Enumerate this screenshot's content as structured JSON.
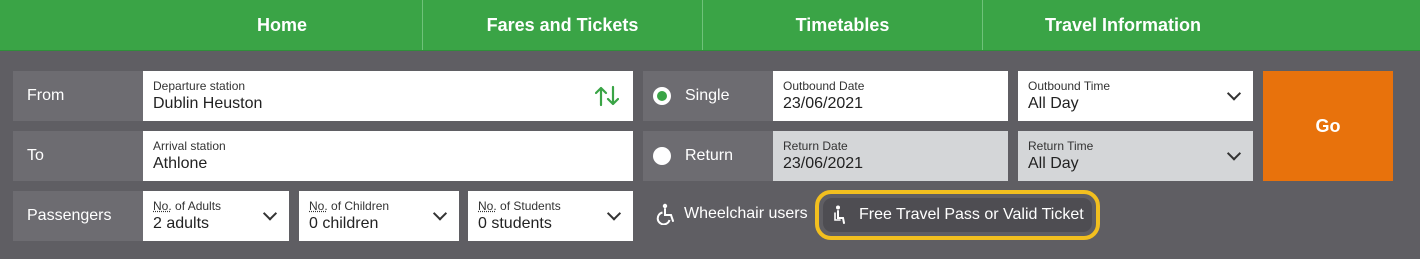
{
  "nav": {
    "items": [
      {
        "label": "Home"
      },
      {
        "label": "Fares and Tickets"
      },
      {
        "label": "Timetables"
      },
      {
        "label": "Travel Information"
      }
    ]
  },
  "journey": {
    "from_label": "From",
    "from_caption": "Departure station",
    "from_value": "Dublin Heuston",
    "to_label": "To",
    "to_caption": "Arrival station",
    "to_value": "Athlone",
    "swap_icon": "swap-arrows-icon"
  },
  "trip_type": {
    "single_label": "Single",
    "return_label": "Return",
    "selected": "Single",
    "accent_color": "#3aa446"
  },
  "dates": {
    "outbound_date_caption": "Outbound Date",
    "outbound_date_value": "23/06/2021",
    "outbound_time_caption": "Outbound Time",
    "outbound_time_value": "All Day",
    "return_date_caption": "Return Date",
    "return_date_value": "23/06/2021",
    "return_time_caption": "Return Time",
    "return_time_value": "All Day"
  },
  "go_button": {
    "label": "Go",
    "color": "#e8720c"
  },
  "passengers": {
    "label": "Passengers",
    "adults_abbr": "No.",
    "adults_caption": " of Adults",
    "adults_value": "2 adults",
    "children_abbr": "No.",
    "children_caption": " of Children",
    "children_value": "0 children",
    "students_abbr": "No.",
    "students_caption": " of Students",
    "students_value": "0 students"
  },
  "accessibility": {
    "wheelchair_label": "Wheelchair users",
    "free_pass_label": "Free Travel Pass or Valid Ticket",
    "highlight_color": "#f2bf1f",
    "wheelchair_icon": "wheelchair-icon",
    "companion_icon": "seated-person-icon"
  }
}
